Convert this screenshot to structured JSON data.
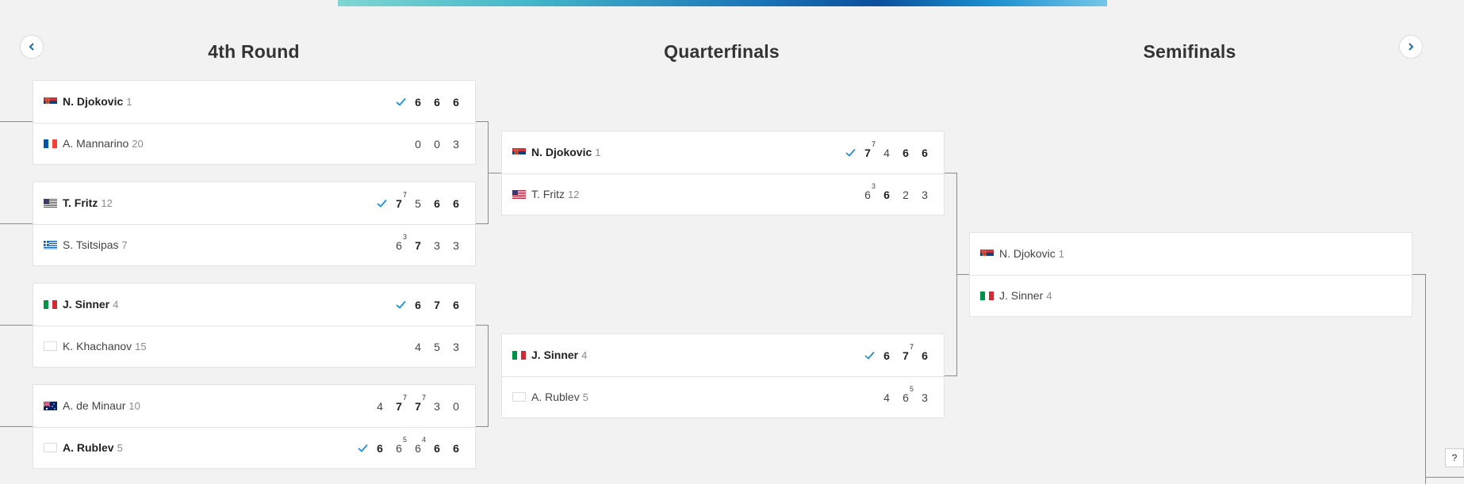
{
  "rounds": {
    "r4": "4th Round",
    "qf": "Quarterfinals",
    "sf": "Semifinals"
  },
  "nav": {
    "prev_icon": "chevron-left-icon",
    "next_icon": "chevron-right-icon"
  },
  "help_label": "?",
  "colors": {
    "accent": "#1b8fd6",
    "nav": "#1b6fa8"
  },
  "r4_matches": [
    {
      "p1": {
        "name": "N. Djokovic",
        "seed": "1",
        "flag": "serbia",
        "winner": true,
        "scores": [
          {
            "v": "6",
            "w": true
          },
          {
            "v": "6",
            "w": true
          },
          {
            "v": "6",
            "w": true
          }
        ]
      },
      "p2": {
        "name": "A. Mannarino",
        "seed": "20",
        "flag": "france",
        "winner": false,
        "scores": [
          {
            "v": "0"
          },
          {
            "v": "0"
          },
          {
            "v": "3"
          }
        ]
      }
    },
    {
      "p1": {
        "name": "T. Fritz",
        "seed": "12",
        "flag": "usa",
        "winner": true,
        "scores": [
          {
            "v": "7",
            "t": "7",
            "w": true
          },
          {
            "v": "5"
          },
          {
            "v": "6",
            "w": true
          },
          {
            "v": "6",
            "w": true
          }
        ]
      },
      "p2": {
        "name": "S. Tsitsipas",
        "seed": "7",
        "flag": "greece",
        "winner": false,
        "scores": [
          {
            "v": "6",
            "t": "3"
          },
          {
            "v": "7",
            "w": true
          },
          {
            "v": "3"
          },
          {
            "v": "3"
          }
        ]
      }
    },
    {
      "p1": {
        "name": "J. Sinner",
        "seed": "4",
        "flag": "italy",
        "winner": true,
        "scores": [
          {
            "v": "6",
            "w": true
          },
          {
            "v": "7",
            "w": true
          },
          {
            "v": "6",
            "w": true
          }
        ]
      },
      "p2": {
        "name": "K. Khachanov",
        "seed": "15",
        "flag": "blank",
        "winner": false,
        "scores": [
          {
            "v": "4"
          },
          {
            "v": "5"
          },
          {
            "v": "3"
          }
        ]
      }
    },
    {
      "p1": {
        "name": "A. de Minaur",
        "seed": "10",
        "flag": "australia",
        "winner": false,
        "scores": [
          {
            "v": "4"
          },
          {
            "v": "7",
            "t": "7",
            "w": true
          },
          {
            "v": "7",
            "t": "7",
            "w": true
          },
          {
            "v": "3"
          },
          {
            "v": "0"
          }
        ]
      },
      "p2": {
        "name": "A. Rublev",
        "seed": "5",
        "flag": "blank",
        "winner": true,
        "scores": [
          {
            "v": "6",
            "w": true
          },
          {
            "v": "6",
            "t": "5"
          },
          {
            "v": "6",
            "t": "4"
          },
          {
            "v": "6",
            "w": true
          },
          {
            "v": "6",
            "w": true
          }
        ]
      }
    }
  ],
  "qf_matches": [
    {
      "p1": {
        "name": "N. Djokovic",
        "seed": "1",
        "flag": "serbia",
        "winner": true,
        "scores": [
          {
            "v": "7",
            "t": "7",
            "w": true
          },
          {
            "v": "4"
          },
          {
            "v": "6",
            "w": true
          },
          {
            "v": "6",
            "w": true
          }
        ]
      },
      "p2": {
        "name": "T. Fritz",
        "seed": "12",
        "flag": "usa",
        "winner": false,
        "scores": [
          {
            "v": "6",
            "t": "3"
          },
          {
            "v": "6",
            "w": true
          },
          {
            "v": "2"
          },
          {
            "v": "3"
          }
        ]
      }
    },
    {
      "p1": {
        "name": "J. Sinner",
        "seed": "4",
        "flag": "italy",
        "winner": true,
        "scores": [
          {
            "v": "6",
            "w": true
          },
          {
            "v": "7",
            "t": "7",
            "w": true
          },
          {
            "v": "6",
            "w": true
          }
        ]
      },
      "p2": {
        "name": "A. Rublev",
        "seed": "5",
        "flag": "blank",
        "winner": false,
        "scores": [
          {
            "v": "4"
          },
          {
            "v": "6",
            "t": "5"
          },
          {
            "v": "3"
          }
        ]
      }
    }
  ],
  "sf_matches": [
    {
      "p1": {
        "name": "N. Djokovic",
        "seed": "1",
        "flag": "serbia",
        "winner": false,
        "scores": []
      },
      "p2": {
        "name": "J. Sinner",
        "seed": "4",
        "flag": "italy",
        "winner": false,
        "scores": []
      }
    }
  ]
}
